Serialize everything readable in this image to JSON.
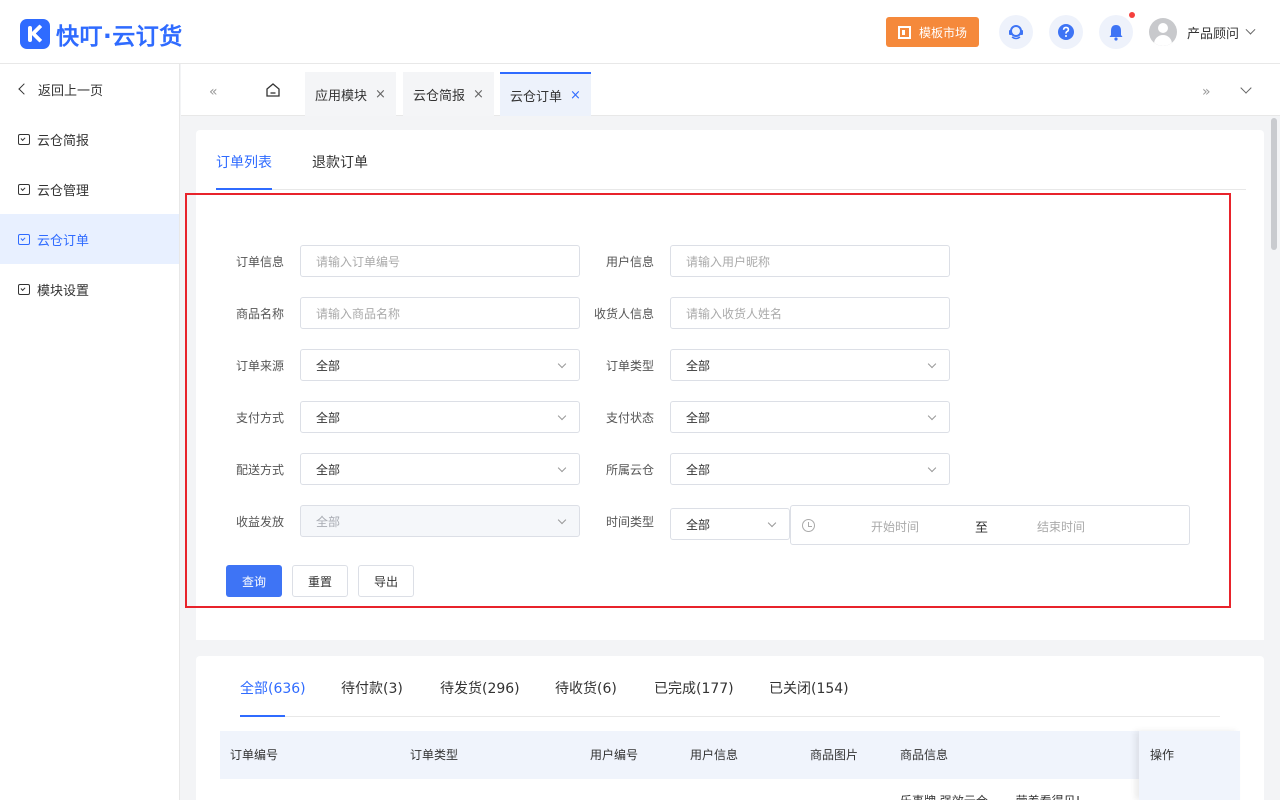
{
  "app": {
    "logo_text": "快叮·云订货"
  },
  "header": {
    "market_label": "模板市场",
    "user_name": "产品顾问",
    "accent": "#2f6bff",
    "market_color": "#f5893b"
  },
  "sidebar": {
    "back_label": "返回上一页",
    "items": [
      {
        "label": "云仓简报"
      },
      {
        "label": "云仓管理"
      },
      {
        "label": "云仓订单"
      },
      {
        "label": "模块设置"
      }
    ]
  },
  "tabs": {
    "prev_glyph": "«",
    "next_glyph": "»",
    "items": [
      {
        "label": "应用模块",
        "close": "×"
      },
      {
        "label": "云仓简报",
        "close": "×"
      },
      {
        "label": "云仓订单",
        "close": "×"
      }
    ]
  },
  "subtabs": [
    "订单列表",
    "退款订单"
  ],
  "filters": {
    "order_info": {
      "label": "订单信息",
      "placeholder": "请输入订单编号"
    },
    "user_info": {
      "label": "用户信息",
      "placeholder": "请输入用户昵称"
    },
    "product_name": {
      "label": "商品名称",
      "placeholder": "请输入商品名称"
    },
    "consignee": {
      "label": "收货人信息",
      "placeholder": "请输入收货人姓名"
    },
    "order_source": {
      "label": "订单来源",
      "value": "全部"
    },
    "order_type": {
      "label": "订单类型",
      "value": "全部"
    },
    "pay_method": {
      "label": "支付方式",
      "value": "全部"
    },
    "pay_status": {
      "label": "支付状态",
      "value": "全部"
    },
    "delivery": {
      "label": "配送方式",
      "value": "全部"
    },
    "warehouse": {
      "label": "所属云仓",
      "value": "全部"
    },
    "revenue": {
      "label": "收益发放",
      "value": "全部"
    },
    "time_type": {
      "label": "时间类型",
      "value": "全部"
    },
    "date_range": {
      "start": "开始时间",
      "separator": "至",
      "end": "结束时间"
    }
  },
  "buttons": {
    "query": "查询",
    "reset": "重置",
    "export": "导出"
  },
  "order_tabs": [
    "全部(636)",
    "待付款(3)",
    "待发货(296)",
    "待收货(6)",
    "已完成(177)",
    "已关闭(154)"
  ],
  "table": {
    "headers": [
      "订单编号",
      "订单类型",
      "用户编号",
      "用户信息",
      "商品图片",
      "商品信息",
      "操作"
    ],
    "first_row_peek": "乐事牌 强效云仓……  营养看得见!"
  }
}
